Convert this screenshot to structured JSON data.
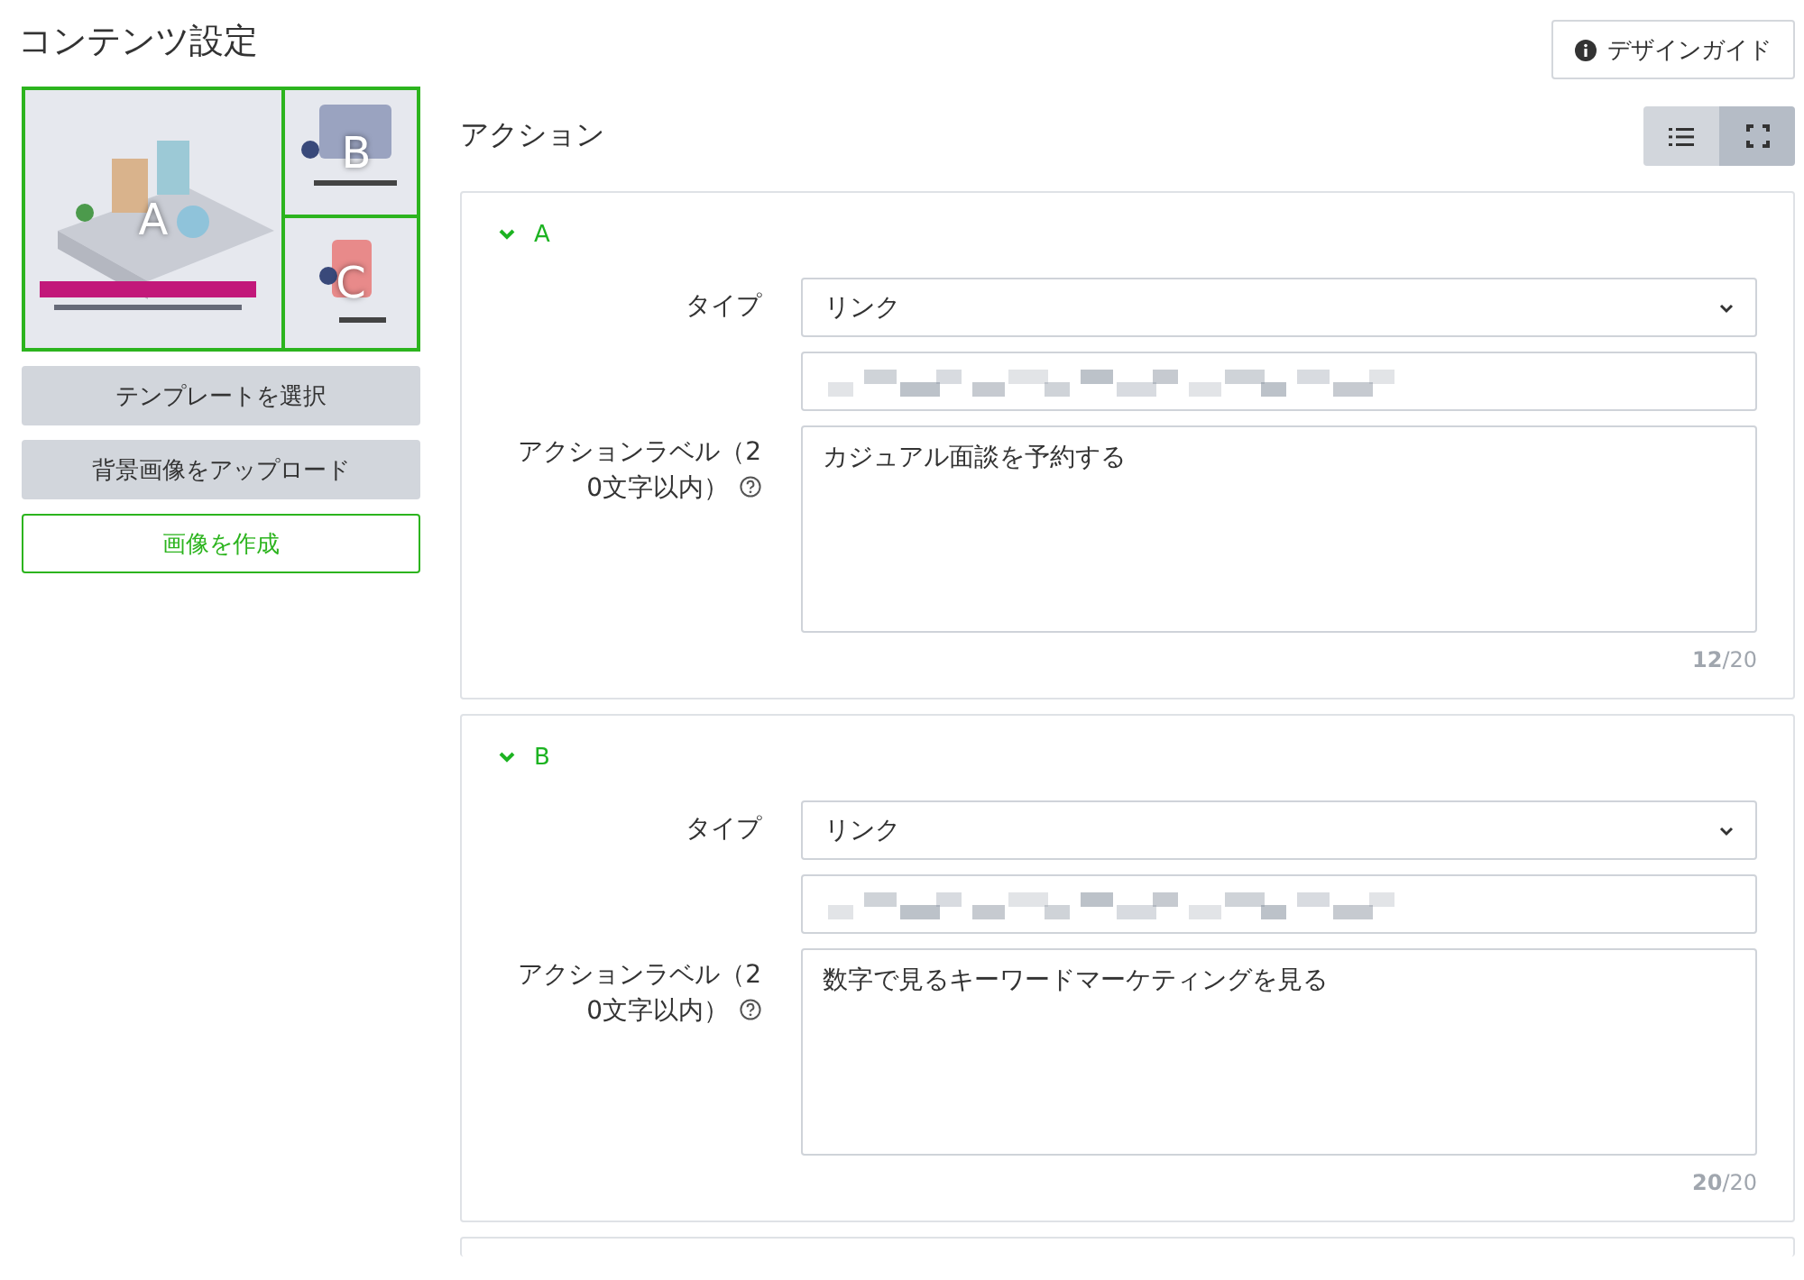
{
  "title": "コンテンツ設定",
  "design_guide_button": "デザインガイド",
  "preview": {
    "areas": [
      {
        "label": "A"
      },
      {
        "label": "B"
      },
      {
        "label": "C"
      }
    ]
  },
  "side_buttons": [
    {
      "label": "テンプレートを選択",
      "kind": "secondary"
    },
    {
      "label": "背景画像をアップロード",
      "kind": "secondary"
    },
    {
      "label": "画像を作成",
      "kind": "outline"
    }
  ],
  "section_title": "アクション",
  "view_toggle": [
    {
      "kind": "list",
      "selected": false
    },
    {
      "kind": "fullscreen",
      "selected": true
    }
  ],
  "actions": [
    {
      "name": "A",
      "expanded": true,
      "type_label": "タイプ",
      "type_value": "リンク",
      "label_caption": "アクションラベル（20文字以内）",
      "label_value": "カジュアル面談を予約する",
      "counter": "**12**/20"
    },
    {
      "name": "B",
      "expanded": true,
      "type_label": "タイプ",
      "type_value": "リンク",
      "label_caption": "アクションラベル（20文字以内）",
      "label_value": "数字で見るキーワードマーケティングを見る",
      "counter": "**20**/20"
    }
  ]
}
